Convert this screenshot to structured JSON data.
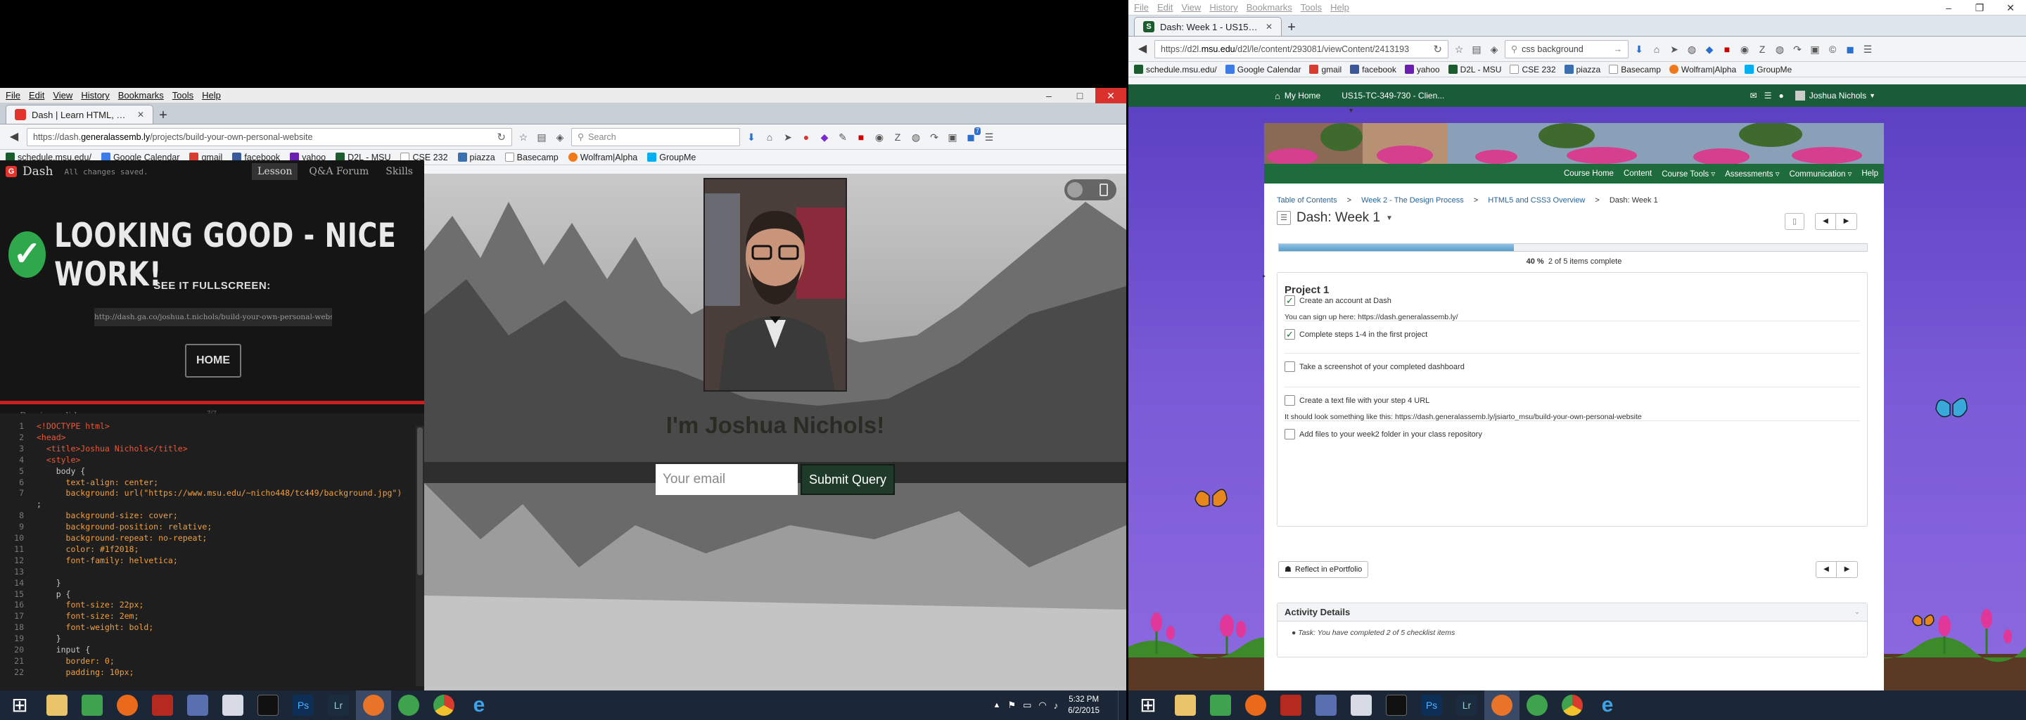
{
  "left_browser": {
    "menu": [
      "File",
      "Edit",
      "View",
      "History",
      "Bookmarks",
      "Tools",
      "Help"
    ],
    "tab_title": "Dash | Learn HTML, CSS, Ja...",
    "url_prefix": "https://dash.",
    "url_host": "generalassemb.ly",
    "url_path": "/projects/build-your-own-personal-website",
    "search_placeholder": "Search",
    "bookmarks": [
      "schedule.msu.edu/",
      "Google Calendar",
      "gmail",
      "facebook",
      "yahoo",
      "D2L - MSU",
      "CSE 232",
      "piazza",
      "Basecamp",
      "Wolfram|Alpha",
      "GroupMe"
    ],
    "badge_count": "7"
  },
  "dash": {
    "brand": "Dash",
    "save_status": "All changes saved.",
    "tabs": [
      "Lesson",
      "Q&A Forum",
      "Skills"
    ],
    "success_title": "LOOKING GOOD - NICE WORK!",
    "fullscreen_label": "SEE IT FULLSCREEN:",
    "fullscreen_url": "http://dash.ga.co/joshua.t.nichols/build-your-own-personal-website",
    "home_button": "HOME",
    "prev_slide": "Previous slide",
    "slide_counter": "7/7"
  },
  "code_lines": [
    {
      "n": "1",
      "c": "<!DOCTYPE html>"
    },
    {
      "n": "2",
      "c": "<head>"
    },
    {
      "n": "3",
      "c": "  <title>Joshua Nichols</title>"
    },
    {
      "n": "4",
      "c": "  <style>"
    },
    {
      "n": "5",
      "c": "    body {"
    },
    {
      "n": "6",
      "c": "      text-align: center;"
    },
    {
      "n": "7",
      "c": "      background: url(\"https://www.msu.edu/~nicho448/tc449/background.jpg\")"
    },
    {
      "n": "",
      "c": ";"
    },
    {
      "n": "8",
      "c": "      background-size: cover;"
    },
    {
      "n": "9",
      "c": "      background-position: relative;"
    },
    {
      "n": "10",
      "c": "      background-repeat: no-repeat;"
    },
    {
      "n": "11",
      "c": "      color: #1f2018;"
    },
    {
      "n": "12",
      "c": "      font-family: helvetica;"
    },
    {
      "n": "13",
      "c": ""
    },
    {
      "n": "14",
      "c": "    }"
    },
    {
      "n": "15",
      "c": "    p {"
    },
    {
      "n": "16",
      "c": "      font-size: 22px;"
    },
    {
      "n": "17",
      "c": "      font-size: 2em;"
    },
    {
      "n": "18",
      "c": "      font-weight: bold;"
    },
    {
      "n": "19",
      "c": "    }"
    },
    {
      "n": "20",
      "c": "    input {"
    },
    {
      "n": "21",
      "c": "      border: 0;"
    },
    {
      "n": "22",
      "c": "      padding: 10px;"
    }
  ],
  "preview": {
    "heading": "I'm Joshua Nichols!",
    "email_placeholder": "Your email",
    "submit_label": "Submit Query"
  },
  "right_browser": {
    "menu": [
      "File",
      "Edit",
      "View",
      "History",
      "Bookmarks",
      "Tools",
      "Help"
    ],
    "tab_title": "Dash: Week 1 - US15-TC-3...",
    "url_prefix": "https://d2l.",
    "url_host": "msu.edu",
    "url_path": "/d2l/le/content/293081/viewContent/2413193",
    "search_value": "css background",
    "bookmarks": [
      "schedule.msu.edu/",
      "Google Calendar",
      "gmail",
      "facebook",
      "yahoo",
      "D2L - MSU",
      "CSE 232",
      "piazza",
      "Basecamp",
      "Wolfram|Alpha",
      "GroupMe"
    ]
  },
  "d2l": {
    "my_home": "My Home",
    "course": "US15-TC-349-730 - Clien...",
    "user": "Joshua Nichols",
    "nav": [
      "Course Home",
      "Content",
      "Course Tools",
      "Assessments",
      "Communication",
      "Help"
    ],
    "breadcrumb": [
      "Table of Contents",
      "Week 2 - The Design Process",
      "HTML5 and CSS3 Overview",
      "Dash: Week 1"
    ],
    "page_title": "Dash: Week 1",
    "progress_percent": "40 %",
    "progress_text": "2 of 5 items complete",
    "progress_value": 0.4,
    "project_title": "Project 1",
    "items": [
      {
        "label": "Create an account at Dash",
        "checked": true,
        "note": "You can sign up here: https://dash.generalassemb.ly/"
      },
      {
        "label": "Complete steps 1-4 in the first project",
        "checked": true,
        "note": ""
      },
      {
        "label": "Take a screenshot of your completed dashboard",
        "checked": false,
        "note": ""
      },
      {
        "label": "Create a text file with your step 4 URL",
        "checked": false,
        "note": "It should look something like this: https://dash.generalassemb.ly/jsiarto_msu/build-your-own-personal-website"
      },
      {
        "label": "Add files to your week2 folder in your class repository",
        "checked": false,
        "note": ""
      }
    ],
    "reflect_label": "Reflect in ePortfolio",
    "activity_title": "Activity Details",
    "activity_text": "Task: You have completed 2 of 5 checklist items"
  },
  "taskbar": {
    "time": "5:32 PM",
    "date": "6/2/2015"
  }
}
